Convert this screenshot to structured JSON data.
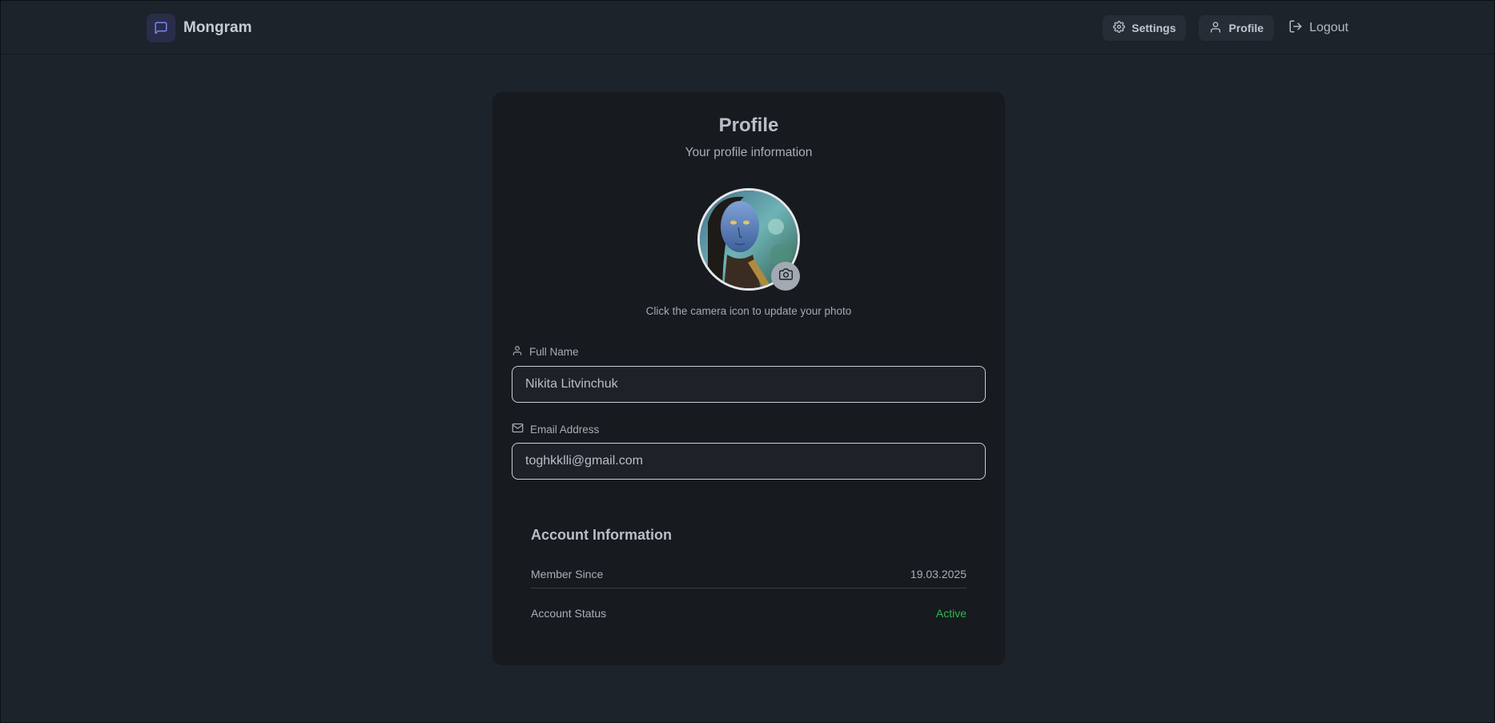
{
  "app": {
    "name": "Mongram"
  },
  "nav": {
    "settings": "Settings",
    "profile": "Profile",
    "logout": "Logout"
  },
  "profile": {
    "title": "Profile",
    "subtitle": "Your profile information",
    "avatar_hint": "Click the camera icon to update your photo",
    "full_name_label": "Full Name",
    "full_name_value": "Nikita Litvinchuk",
    "email_label": "Email Address",
    "email_value": "toghkklli@gmail.com"
  },
  "account": {
    "title": "Account Information",
    "member_since_label": "Member Since",
    "member_since_value": "19.03.2025",
    "status_label": "Account Status",
    "status_value": "Active"
  },
  "colors": {
    "background": "#1d232a",
    "card": "#171a1e",
    "accent": "#6b73e0",
    "status_active": "#2db84b"
  },
  "icons": {
    "brand": "chat-bubble-icon",
    "settings": "gear-icon",
    "profile": "user-icon",
    "logout": "logout-icon",
    "camera": "camera-icon",
    "full_name": "user-icon",
    "email": "mail-icon"
  }
}
